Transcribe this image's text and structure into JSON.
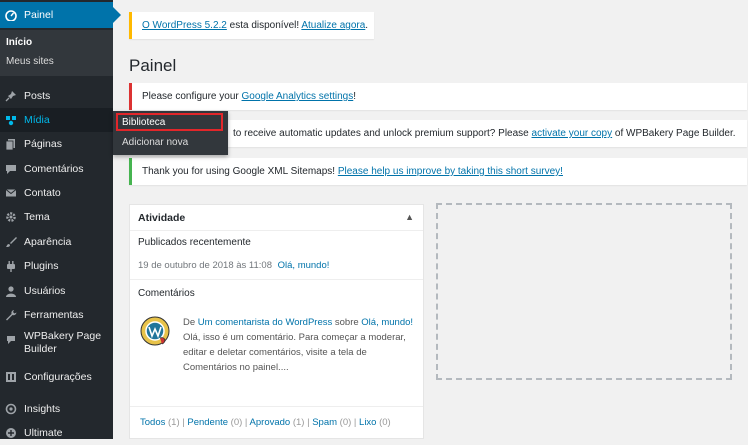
{
  "sidebar": {
    "items": [
      {
        "label": "Painel",
        "icon": "dashboard-icon"
      },
      {
        "label": "Posts",
        "icon": "pin-icon"
      },
      {
        "label": "Mídia",
        "icon": "media-icon"
      },
      {
        "label": "Páginas",
        "icon": "pages-icon"
      },
      {
        "label": "Comentários",
        "icon": "comments-icon"
      },
      {
        "label": "Contato",
        "icon": "mail-icon"
      },
      {
        "label": "Tema",
        "icon": "gear-icon"
      },
      {
        "label": "Aparência",
        "icon": "brush-icon"
      },
      {
        "label": "Plugins",
        "icon": "plugin-icon"
      },
      {
        "label": "Usuários",
        "icon": "user-icon"
      },
      {
        "label": "Ferramentas",
        "icon": "wrench-icon"
      },
      {
        "label": "WPBakery Page",
        "label2": "Builder",
        "icon": "wpbakery-icon"
      },
      {
        "label": "Configurações",
        "icon": "settings-icon"
      },
      {
        "label": "Insights",
        "icon": "insights-icon"
      },
      {
        "label": "Ultimate",
        "icon": "ultimate-icon"
      }
    ],
    "submenu": [
      "Início",
      "Meus sites"
    ]
  },
  "flyout": {
    "items": [
      "Biblioteca",
      "Adicionar nova"
    ]
  },
  "notices": {
    "update": {
      "link1": "O WordPress 5.2.2",
      "mid": " esta disponível! ",
      "link2": "Atualize agora",
      "end": "."
    },
    "analytics": {
      "text": "Please configure your ",
      "link": "Google Analytics settings",
      "end": "!"
    },
    "wpbakery": {
      "text": "to receive automatic updates and unlock premium support? Please ",
      "link": "activate your copy",
      "end": " of WPBakery Page Builder."
    },
    "sitemaps": {
      "text": "Thank you for using Google XML Sitemaps! ",
      "link": "Please help us improve by taking this short survey!"
    }
  },
  "page_title": "Painel",
  "activity": {
    "title": "Atividade",
    "toggle": "▲",
    "recent_heading": "Publicados recentemente",
    "recent_date": "19 de outubro de 2018 às 11:08",
    "recent_link": "Olá, mundo!",
    "comments_heading": "Comentários",
    "comment": {
      "prefix": "De ",
      "author": "Um comentarista do WordPress",
      "on": " sobre ",
      "post": "Olá, mundo!",
      "line1": "Olá, isso é um comentário. Para começar a moderar,",
      "line2": "editar e deletar comentários, visite a tela de",
      "line3": "Comentários no painel...."
    },
    "filters": [
      {
        "label": "Todos",
        "count": " (1)"
      },
      {
        "label": "Pendente",
        "count": " (0)"
      },
      {
        "label": "Aprovado",
        "count": " (1)"
      },
      {
        "label": "Spam",
        "count": " (0)"
      },
      {
        "label": "Lixo",
        "count": " (0)"
      }
    ],
    "sep": " | "
  },
  "colors": {
    "accent": "#0073aa",
    "sidebar": "#23282d",
    "highlight": "#e2262a"
  }
}
